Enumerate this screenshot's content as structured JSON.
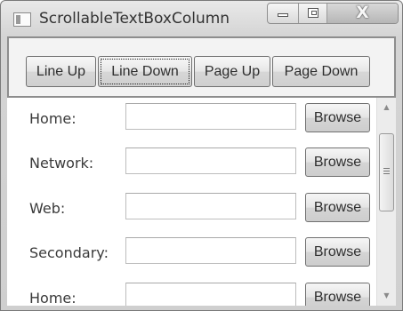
{
  "window": {
    "title": "ScrollableTextBoxColumn",
    "controls": {
      "minimize": "minimize",
      "maximize": "maximize",
      "close": "X"
    }
  },
  "toolbar": {
    "line_up": "Line Up",
    "line_down": "Line Down",
    "page_up": "Page Up",
    "page_down": "Page Down"
  },
  "rows": [
    {
      "label": "Home:",
      "value": "",
      "button": "Browse"
    },
    {
      "label": "Network:",
      "value": "",
      "button": "Browse"
    },
    {
      "label": "Web:",
      "value": "",
      "button": "Browse"
    },
    {
      "label": "Secondary:",
      "value": "",
      "button": "Browse"
    },
    {
      "label": "Home:",
      "value": "",
      "button": "Browse"
    }
  ],
  "scrollbar": {
    "position": 0.2
  }
}
